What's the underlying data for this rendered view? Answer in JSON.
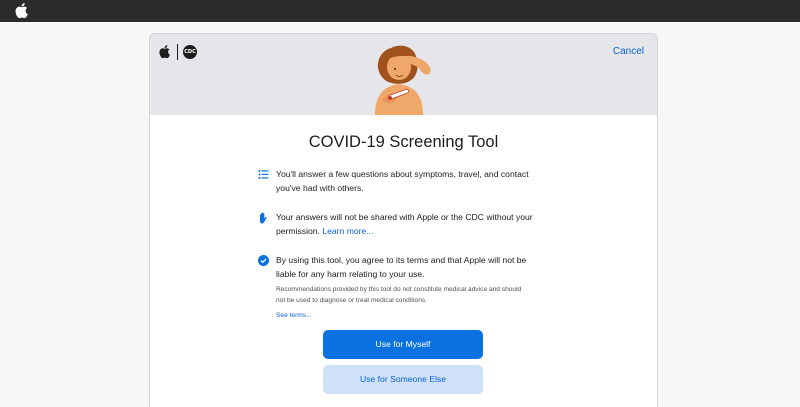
{
  "topbar": {
    "logo_icon": "apple-logo-icon"
  },
  "header": {
    "logos": [
      "apple-logo-icon",
      "cdc-logo-icon"
    ],
    "cdc_text": "CDC",
    "cancel_label": "Cancel",
    "illustration": "person-with-thermometer-illustration"
  },
  "main": {
    "title": "COVID-19 Screening Tool",
    "items": [
      {
        "icon": "list-icon",
        "text": "You'll answer a few questions about symptoms, travel, and contact you've had with others."
      },
      {
        "icon": "hand-icon",
        "text": "Your answers will not be shared with Apple or the CDC without your permission.",
        "link": "Learn more..."
      },
      {
        "icon": "checkmark-circle-icon",
        "text": "By using this tool, you agree to its terms and that Apple will not be liable for any harm relating to your use.",
        "fine_print": "Recommendations provided by this tool do not constitute medical advice and should not be used to diagnose or treat medical conditions.",
        "link": "See terms..."
      }
    ],
    "primary_button": "Use for Myself",
    "secondary_button": "Use for Someone Else"
  },
  "colors": {
    "accent": "#0a71e0",
    "link": "#0a63d8",
    "header_bg": "#e5e5ea",
    "topbar_bg": "#2b2b2b",
    "illustration_skin": "#f0a86a",
    "illustration_hair": "#a0521d"
  }
}
